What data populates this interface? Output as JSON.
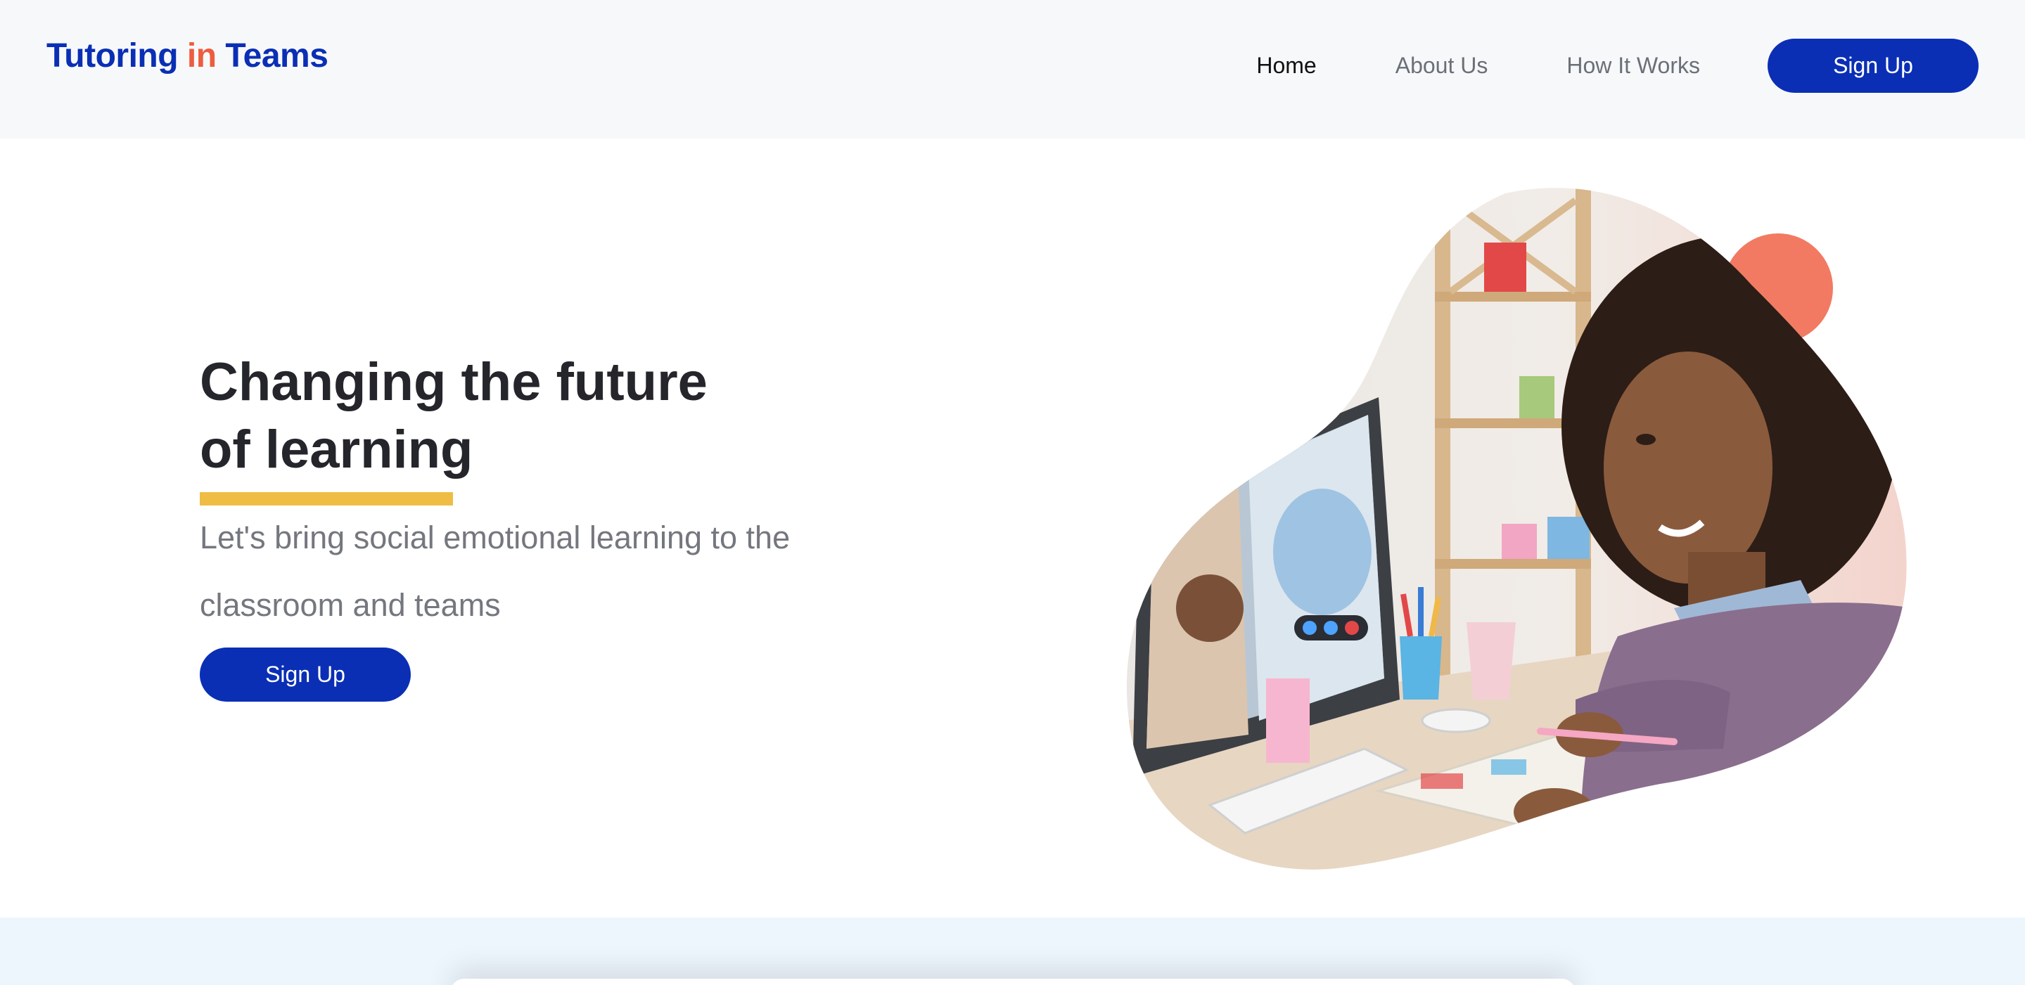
{
  "brand": {
    "logo_part1": "Tutoring",
    "logo_part2": "in",
    "logo_part3": "Teams",
    "primary_color": "#0a2fb5",
    "accent_color": "#ee5b3f",
    "highlight_color": "#efbd44"
  },
  "nav": {
    "items": [
      {
        "label": "Home",
        "active": true
      },
      {
        "label": "About Us",
        "active": false
      },
      {
        "label": "How It Works",
        "active": false
      }
    ],
    "signup_label": "Sign Up"
  },
  "hero": {
    "headline_line1": "Changing the future",
    "headline_line2": "of learning",
    "subtext": "Let's bring social emotional learning to the classroom and teams",
    "cta_label": "Sign Up",
    "image_icon": "student-video-call-illustration"
  }
}
